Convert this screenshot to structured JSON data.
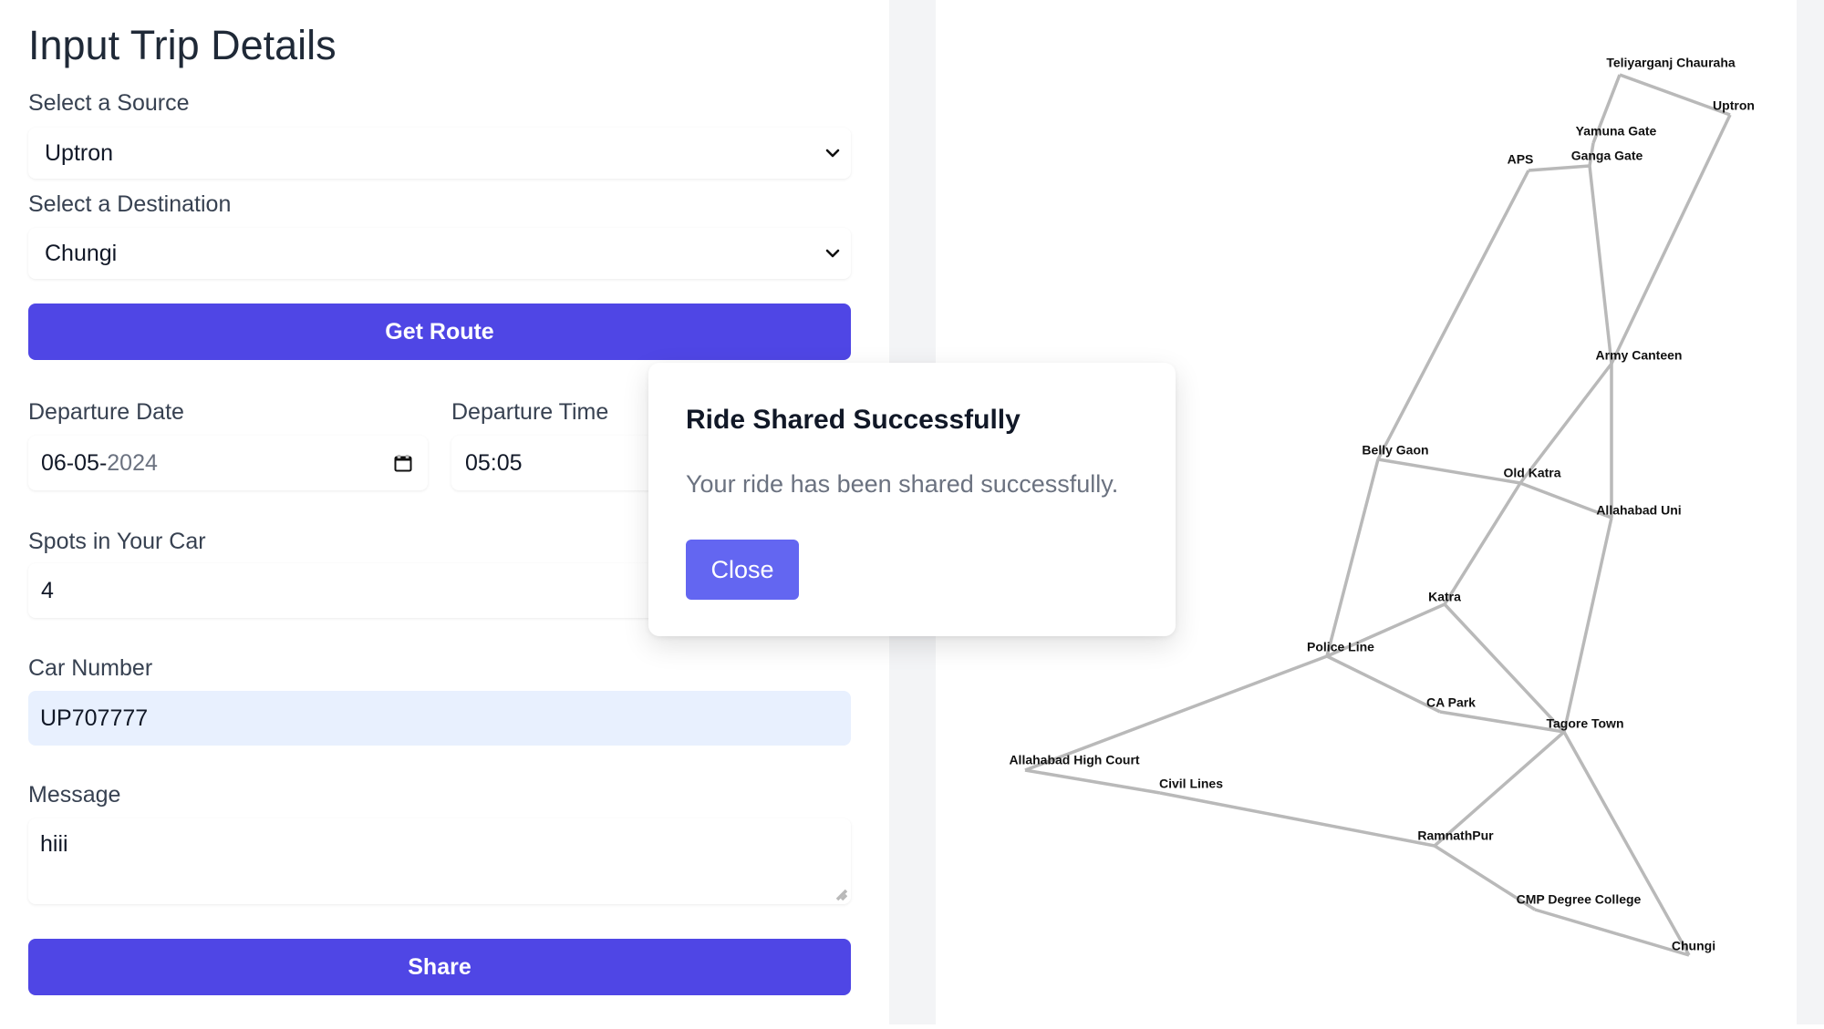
{
  "form": {
    "title": "Input Trip Details",
    "source_label": "Select a Source",
    "source_value": "Uptron",
    "destination_label": "Select a Destination",
    "destination_value": "Chungi",
    "get_route_label": "Get Route",
    "departure_date_label": "Departure Date",
    "departure_date_dm": "06-05-",
    "departure_date_year": "2024",
    "departure_time_label": "Departure Time",
    "departure_time_value": "05:05",
    "spots_label": "Spots in Your Car",
    "spots_value": "4",
    "car_number_label": "Car Number",
    "car_number_value": "UP707777",
    "message_label": "Message",
    "message_value": "hiii",
    "share_label": "Share"
  },
  "modal": {
    "title": "Ride Shared Successfully",
    "body": "Your ride has been shared successfully.",
    "close_label": "Close"
  },
  "map": {
    "nodes": [
      {
        "id": "teliyarganj",
        "label": "Teliyarganj Chauraha"
      },
      {
        "id": "uptron",
        "label": "Uptron"
      },
      {
        "id": "yamuna",
        "label": "Yamuna Gate"
      },
      {
        "id": "aps",
        "label": "APS"
      },
      {
        "id": "ganga",
        "label": "Ganga Gate"
      },
      {
        "id": "army",
        "label": "Army Canteen"
      },
      {
        "id": "belly",
        "label": "Belly Gaon"
      },
      {
        "id": "oldkatra",
        "label": "Old Katra"
      },
      {
        "id": "alluni",
        "label": "Allahabad Uni"
      },
      {
        "id": "katra",
        "label": "Katra"
      },
      {
        "id": "police",
        "label": "Police Line"
      },
      {
        "id": "capark",
        "label": "CA Park"
      },
      {
        "id": "tagore",
        "label": "Tagore Town"
      },
      {
        "id": "highcourt",
        "label": "Allahabad High Court"
      },
      {
        "id": "civil",
        "label": "Civil Lines"
      },
      {
        "id": "ramnath",
        "label": "RamnathPur"
      },
      {
        "id": "cmp",
        "label": "CMP Degree College"
      },
      {
        "id": "chungi",
        "label": "Chungi"
      }
    ],
    "edges": [
      [
        "teliyarganj",
        "uptron"
      ],
      [
        "teliyarganj",
        "yamuna"
      ],
      [
        "yamuna",
        "ganga"
      ],
      [
        "aps",
        "ganga"
      ],
      [
        "uptron",
        "army"
      ],
      [
        "ganga",
        "army"
      ],
      [
        "aps",
        "belly"
      ],
      [
        "army",
        "oldkatra"
      ],
      [
        "army",
        "alluni"
      ],
      [
        "belly",
        "oldkatra"
      ],
      [
        "oldkatra",
        "alluni"
      ],
      [
        "oldkatra",
        "katra"
      ],
      [
        "belly",
        "police"
      ],
      [
        "katra",
        "police"
      ],
      [
        "katra",
        "tagore"
      ],
      [
        "police",
        "capark"
      ],
      [
        "capark",
        "tagore"
      ],
      [
        "alluni",
        "tagore"
      ],
      [
        "police",
        "highcourt"
      ],
      [
        "highcourt",
        "civil"
      ],
      [
        "civil",
        "ramnath"
      ],
      [
        "ramnath",
        "tagore"
      ],
      [
        "ramnath",
        "cmp"
      ],
      [
        "cmp",
        "chungi"
      ],
      [
        "tagore",
        "chungi"
      ]
    ]
  }
}
